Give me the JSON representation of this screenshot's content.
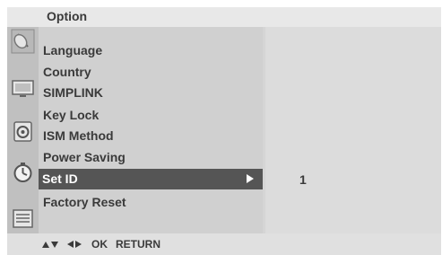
{
  "menu": {
    "title": "Option",
    "items": [
      {
        "label": "Language"
      },
      {
        "label": "Country"
      },
      {
        "label": "SIMPLINK"
      },
      {
        "label": "Key Lock"
      },
      {
        "label": "ISM Method"
      },
      {
        "label": "Power Saving"
      },
      {
        "label": "Set ID",
        "selected": true
      },
      {
        "label": "Factory Reset"
      }
    ],
    "selected_value": "1"
  },
  "icons": [
    {
      "name": "satellite-dish-icon"
    },
    {
      "name": "picture-icon"
    },
    {
      "name": "audio-icon"
    },
    {
      "name": "time-icon"
    },
    {
      "name": "option-icon"
    }
  ],
  "footer": {
    "hint_ok": "OK",
    "hint_return": "RETURN"
  },
  "colors": {
    "header": "#e8e8e8",
    "panel": "#d0d0d0",
    "selected": "#555555",
    "text": "#3a3a3a"
  }
}
